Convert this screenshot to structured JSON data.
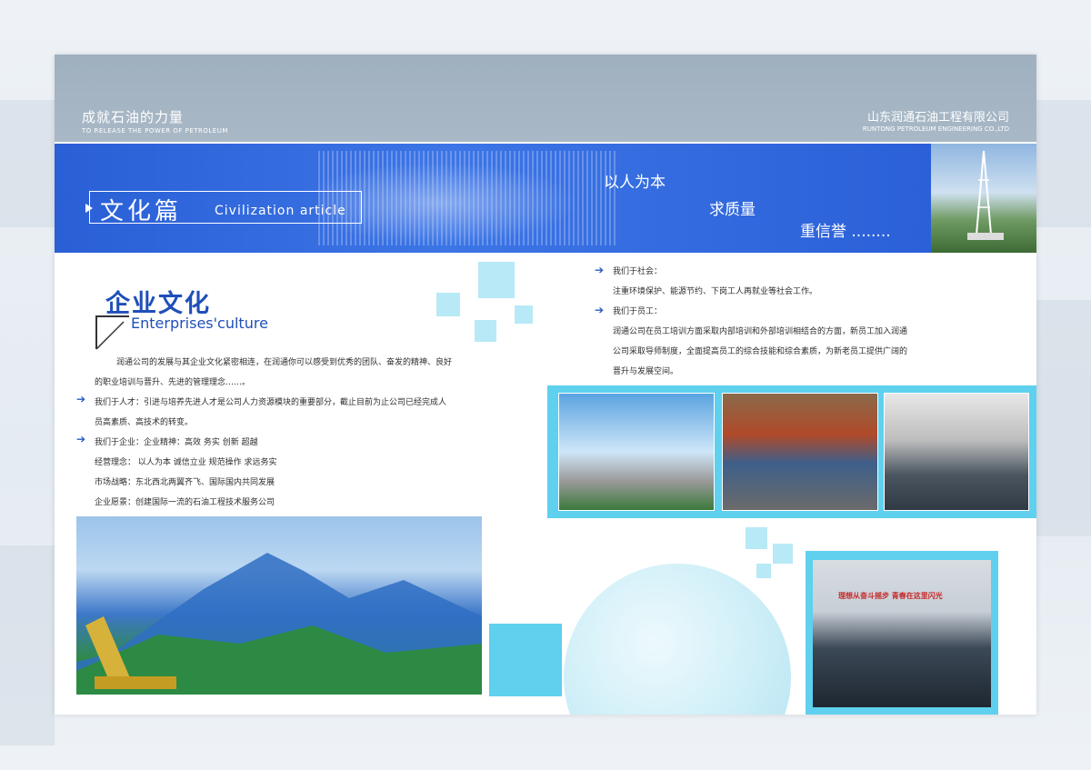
{
  "header": {
    "slogan_cn": "成就石油的力量",
    "slogan_en": "TO RELEASE THE POWER OF PETROLEUM",
    "company_cn": "山东润通石油工程有限公司",
    "company_en": "RUNTONG PETROLEUM ENGINEERING CO.,LTD"
  },
  "banner": {
    "title_cn": "文化篇",
    "title_en": "Civilization article",
    "motto": [
      "以人为本",
      "求质量",
      "重信誉 ........"
    ]
  },
  "culture": {
    "title_cn": "企业文化",
    "title_en": "Enterprises'culture",
    "intro_line1": "润通公司的发展与其企业文化紧密相连，在润通你可以感受到优秀的团队、奋发的精神、良好",
    "intro_line2": "的职业培训与晋升、先进的管理理念……。",
    "talent_line1": "我们于人才：引进与培养先进人才是公司人力资源模块的重要部分，截止目前为止公司已经完成人",
    "talent_line2": "员高素质、高技术的转变。",
    "enterprise_line": "我们于企业：企业精神：高效 务实 创新 超越",
    "philosophy": "经营理念：  以人为本 诚信立业 规范操作 求远务实",
    "strategy": "市场战略：东北西北两翼齐飞、国际国内共同发展",
    "vision": "企业愿景：创建国际一流的石油工程技术服务公司"
  },
  "right": {
    "society_head": "我们于社会：",
    "society_text": "注重环境保护、能源节约、下岗工人再就业等社会工作。",
    "staff_head": "我们于员工：",
    "staff_line1": "润通公司在员工培训方面采取内部培训和外部培训相结合的方面，新员工加入润通",
    "staff_line2": "公司采取导师制度，全面提高员工的综合技能和综合素质，为新老员工提供广阔的",
    "staff_line3": "晋升与发展空间。",
    "meeting_sign": "理想从奋斗摇步 青春在这里闪光"
  },
  "colors": {
    "banner_blue": "#2f66dc",
    "accent_cyan": "#5fd0ee",
    "title_blue": "#1f4fb8",
    "header_gray": "#a5b5c4"
  }
}
